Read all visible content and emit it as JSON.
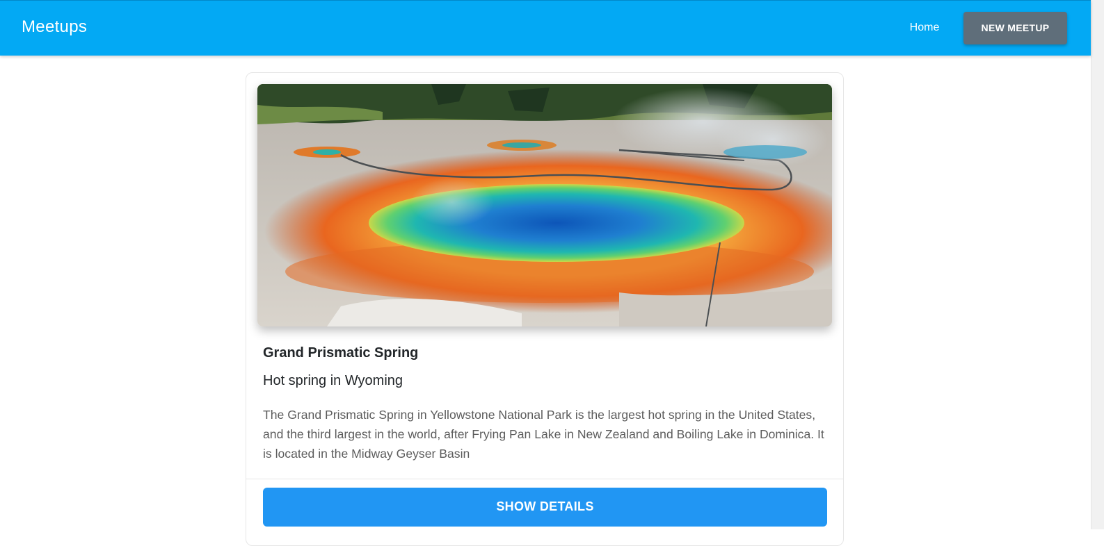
{
  "app": {
    "title": "Meetups",
    "accent_color": "#03a9f4"
  },
  "nav": {
    "home_label": "Home",
    "new_meetup_label": "NEW MEETUP"
  },
  "meetup": {
    "title": "Grand Prismatic Spring",
    "subtitle": "Hot spring in Wyoming",
    "description": "The Grand Prismatic Spring in Yellowstone National Park is the largest hot spring in the United States, and the third largest in the world, after Frying Pan Lake in New Zealand and Boiling Lake in Dominica. It is located in the Midway Geyser Basin",
    "image_subject": "aerial view of a colorful hot spring",
    "action_label": "SHOW DETAILS",
    "action_color": "#2196f3"
  }
}
